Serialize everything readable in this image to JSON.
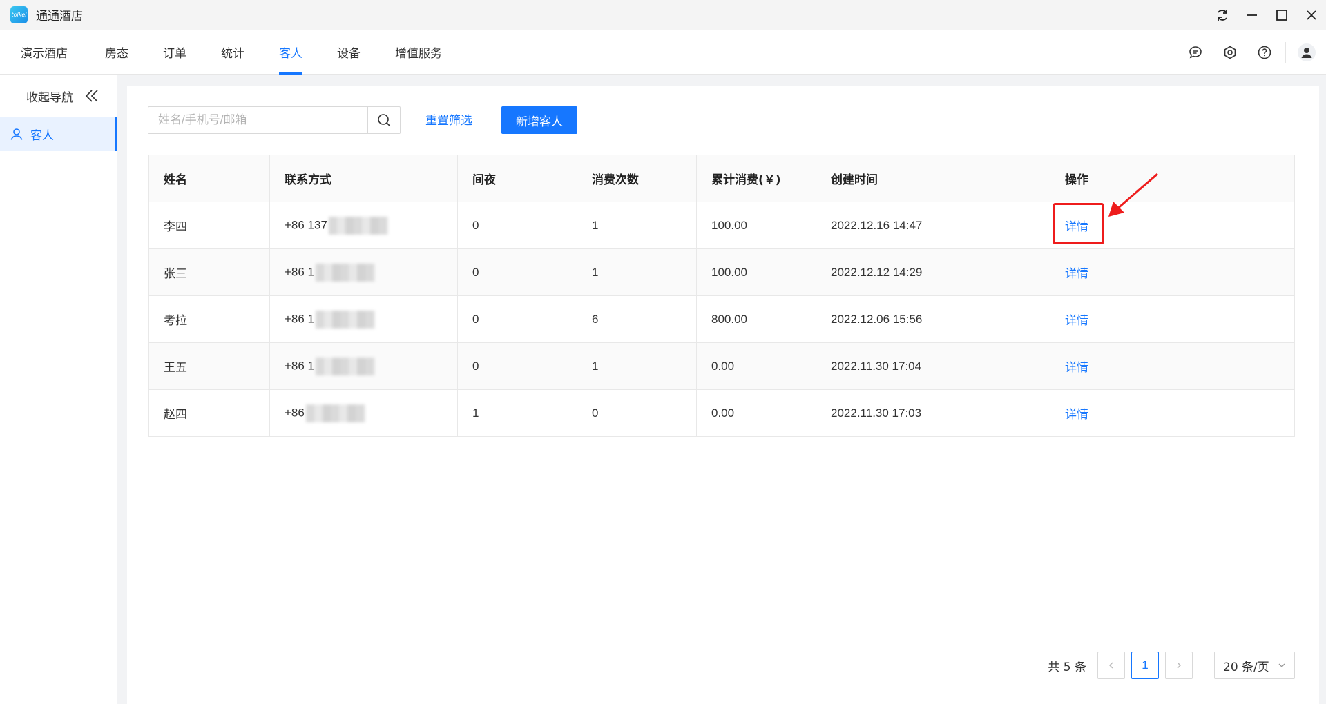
{
  "app": {
    "title": "通通酒店",
    "logo_text": "tolkel"
  },
  "menu": {
    "items": [
      {
        "label": "演示酒店",
        "active": false
      },
      {
        "label": "房态",
        "active": false
      },
      {
        "label": "订单",
        "active": false
      },
      {
        "label": "统计",
        "active": false
      },
      {
        "label": "客人",
        "active": true
      },
      {
        "label": "设备",
        "active": false
      },
      {
        "label": "增值服务",
        "active": false
      }
    ]
  },
  "sidebar": {
    "collapse_label": "收起导航",
    "items": [
      {
        "label": "客人",
        "icon": "user-icon",
        "active": true
      }
    ]
  },
  "toolbar": {
    "search_placeholder": "姓名/手机号/邮箱",
    "reset_label": "重置筛选",
    "add_label": "新增客人"
  },
  "table": {
    "headers": [
      "姓名",
      "联系方式",
      "间夜",
      "消费次数",
      "累计消费(￥)",
      "创建时间",
      "操作"
    ],
    "rows": [
      {
        "name": "李四",
        "contact": "+86 137",
        "nights": "0",
        "visits": "1",
        "spend": "100.00",
        "created": "2022.12.16 14:47",
        "action": "详情"
      },
      {
        "name": "张三",
        "contact": "+86 1",
        "nights": "0",
        "visits": "1",
        "spend": "100.00",
        "created": "2022.12.12 14:29",
        "action": "详情"
      },
      {
        "name": "考拉",
        "contact": "+86 1",
        "nights": "0",
        "visits": "6",
        "spend": "800.00",
        "created": "2022.12.06 15:56",
        "action": "详情"
      },
      {
        "name": "王五",
        "contact": "+86 1",
        "nights": "0",
        "visits": "1",
        "spend": "0.00",
        "created": "2022.11.30 17:04",
        "action": "详情"
      },
      {
        "name": "赵四",
        "contact": "+86",
        "nights": "1",
        "visits": "0",
        "spend": "0.00",
        "created": "2022.11.30 17:03",
        "action": "详情"
      }
    ]
  },
  "pagination": {
    "total_text": "共 5 条",
    "current_page": "1",
    "page_size": "20 条/页"
  },
  "colors": {
    "accent": "#1677ff",
    "annotation": "#ee1c1c"
  }
}
